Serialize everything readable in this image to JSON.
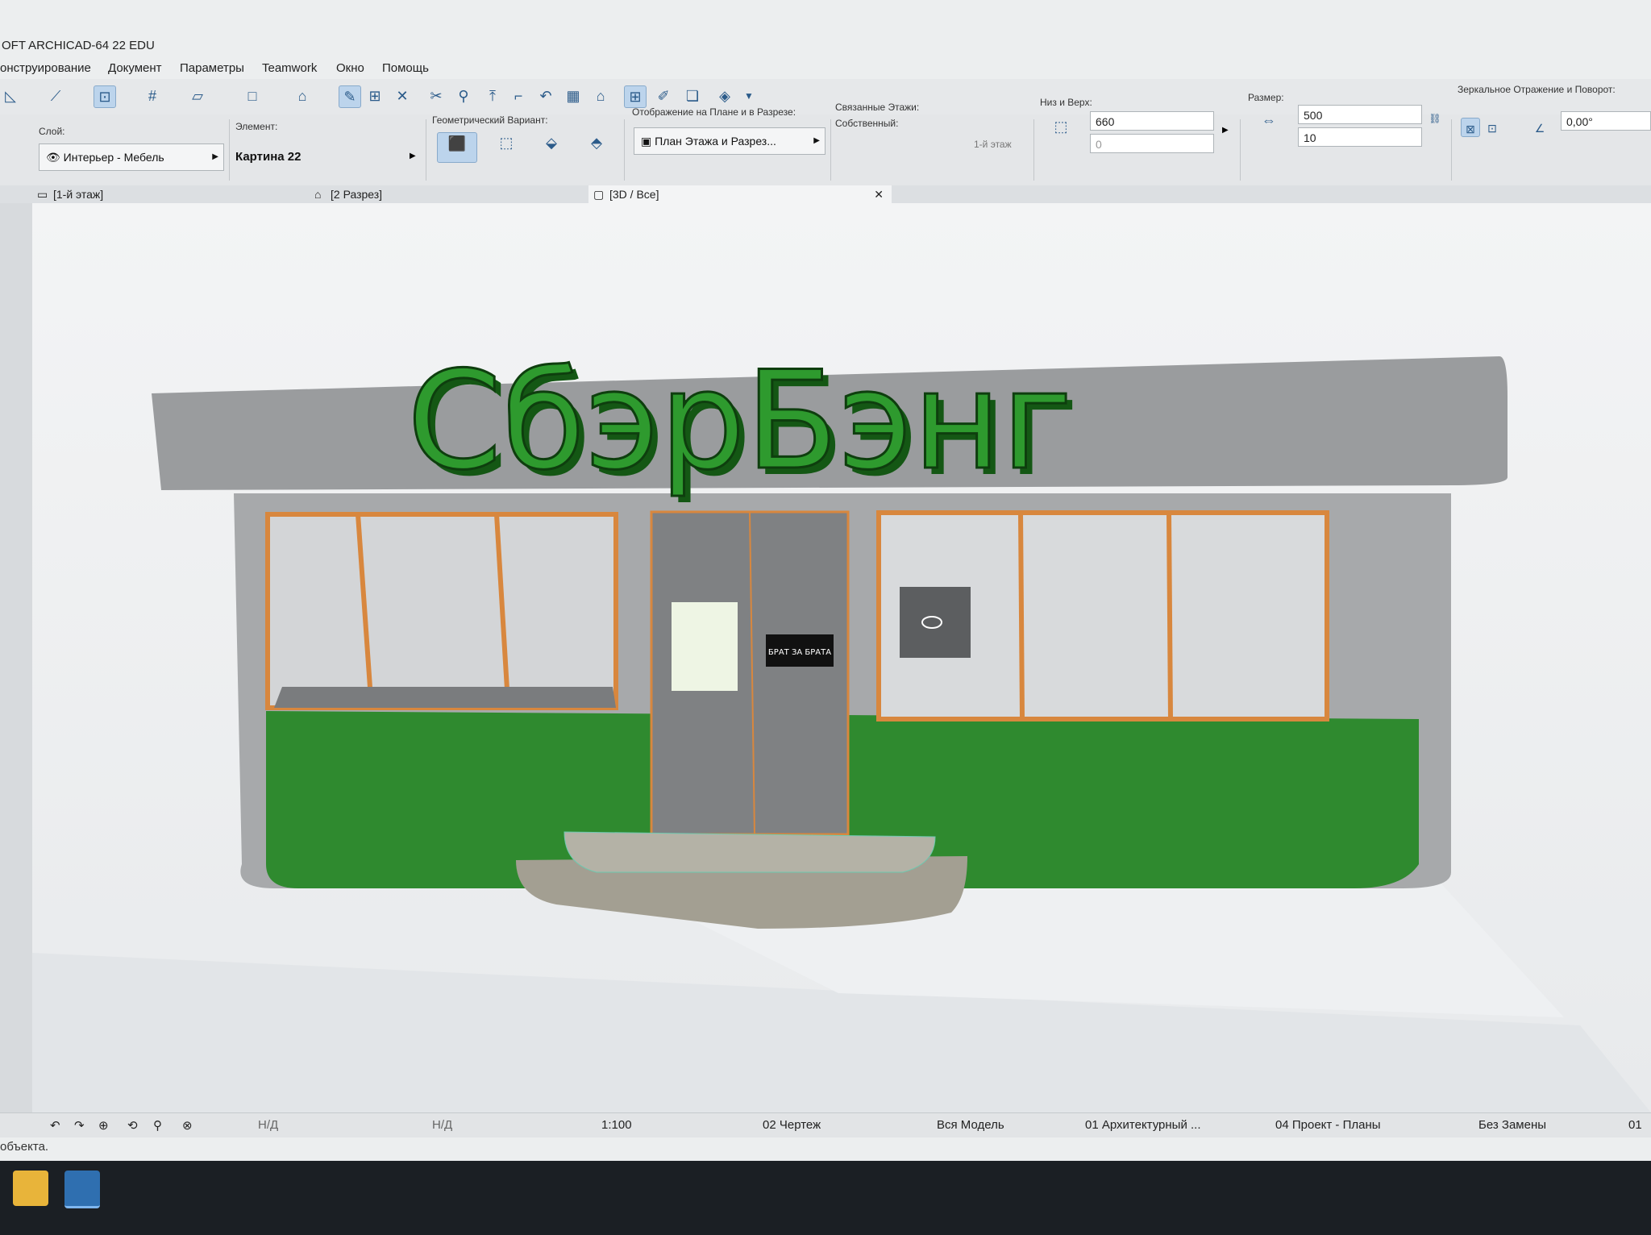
{
  "app": {
    "title": "OFT ARCHICAD-64 22 EDU"
  },
  "menu": [
    "онструирование",
    "Документ",
    "Параметры",
    "Teamwork",
    "Окно",
    "Помощь"
  ],
  "infobox": {
    "layer_label": "Слой:",
    "layer_value": "Интерьер - Мебель",
    "element_label": "Элемент:",
    "element_value": "Картина 22",
    "geom_label": "Геометрический Вариант:",
    "display_label": "Отображение на Плане и в Разрезе:",
    "display_value": "План Этажа и Разрез...",
    "linked_label": "Связанные Этажи:",
    "own_label": "Собственный:",
    "own_value": "1-й этаж",
    "bottomtop_label": "Низ и Верх:",
    "top_value": "660",
    "bottom_value": "0",
    "size_label": "Размер:",
    "width_value": "500",
    "depth_value": "10",
    "mirror_label": "Зеркальное Отражение и Поворот:",
    "angle_value": "0,00°"
  },
  "tabs": [
    "[1-й этаж]",
    "[2 Разрез]",
    "[3D / Все]"
  ],
  "scene": {
    "sign_text": "СбэрБэнг",
    "door_poster_text": "БРАТ ЗА БРАТА",
    "colors": {
      "sign": "#1f7a1f",
      "plinth": "#2f8a2f",
      "frame": "#d8873e",
      "wall": "#a7a9ab",
      "roof": "#9a9c9e",
      "steps": "#b4b2a6"
    }
  },
  "status": {
    "nd1": "Н/Д",
    "nd2": "Н/Д",
    "scale": "1:100",
    "layer_set": "02 Чертеж",
    "model": "Вся Модель",
    "pen_set": "01 Архитектурный ...",
    "view": "04 Проект - Планы",
    "override": "Без Замены",
    "last": "01"
  },
  "hint_text": "объекта."
}
